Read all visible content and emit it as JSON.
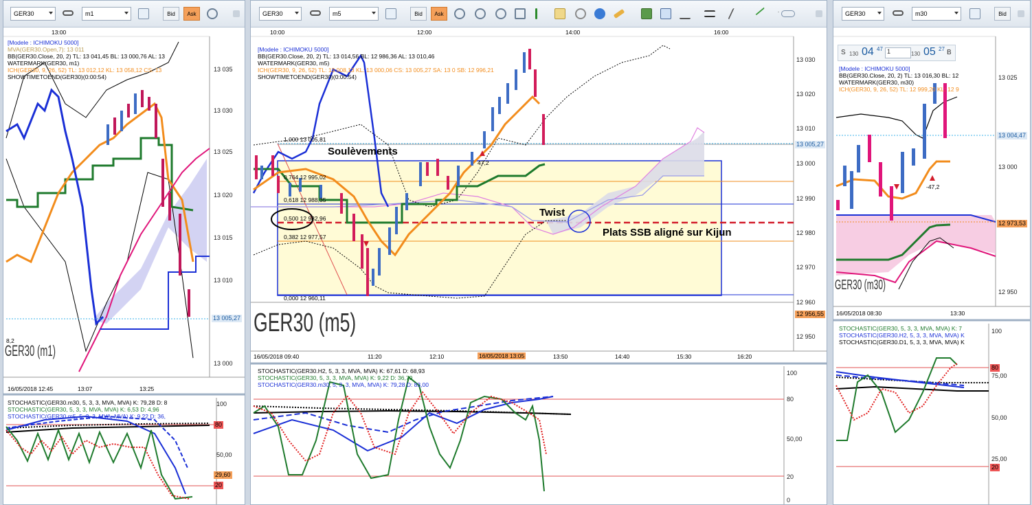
{
  "colors": {
    "ask": "#f5a05a",
    "bid": "#f0f3f6",
    "sar": "#d21c5a",
    "kijun": "#1e7a2c",
    "tenkan": "#f28c1c",
    "bb": "#000000",
    "price_tag": "#dde9f5",
    "alert_tag": "#f5a05a",
    "cloud": "#c8c8f0"
  },
  "left": {
    "symbol": "GER30",
    "timeframe": "m1",
    "bid": "Bid",
    "ask": "Ask",
    "top_time": "13:00",
    "legend": [
      "[Modele : ICHIMOKU 5000]",
      "MVA(GER30.Open,7): 13 011",
      "BB(GER30.Close, 20, 2)  TL: 13 041,45  BL: 13 000,76  AL: 13",
      "WATERMARK(GER30, m1)",
      "ICH(GER30, 9, 26, 52)  TL: 13 012,12  KL: 13 058,12  CS: 13",
      "SHOWTIMETOEND(GER30)(0:00:54)"
    ],
    "yticks": [
      "13 035",
      "13 030",
      "13 025",
      "13 020",
      "13 015",
      "13 010",
      "13 000"
    ],
    "price_tag": "13 005,27",
    "watermark": "GER30 (m1)",
    "xticks": [
      "16/05/2018 12:45",
      "13:07",
      "13:25"
    ],
    "stoch_legend": [
      "STOCHASTIC(GER30.m30, 5, 3, 3, MVA, MVA)  K: 79,28  D: 8",
      "STOCHASTIC(GER30, 5, 3, 3, MVA, MVA)  K: 6,53  D: 4,96",
      "STOCHASTIC(GER30.m5, 5, 3, 3, MVA, MVA)  K: 9,22  D: 36,"
    ],
    "stoch_ticks": [
      "100",
      "80",
      "50,00",
      "29,60",
      "20"
    ],
    "small_note": "8,2"
  },
  "middle": {
    "symbol": "GER30",
    "timeframe": "m5",
    "bid": "Bid",
    "ask": "Ask",
    "top_times": [
      "10:00",
      "12:00",
      "14:00",
      "16:00"
    ],
    "legend": [
      "[Modele : ICHIMOKU 5000]",
      "BB(GER30.Close, 20, 2)  TL: 13 014,56  BL: 12 986,36  AL: 13 010,46",
      "WATERMARK(GER30, m5)",
      "ICH(GER30, 9, 26, 52)  TL: 13 008,13  KL: 13 000,06  CS: 13 005,27  SA: 13 0    SB: 12 996,21",
      "SHOWTIMETOEND(GER30)(0:00:54)"
    ],
    "yticks": [
      "13 030",
      "13 020",
      "13 010",
      "13 000",
      "12 990",
      "12 980",
      "12 970",
      "12 960",
      "12 950"
    ],
    "price_tag": "13 005,27",
    "low_tag": "12 956,55",
    "fib": [
      "1,000 13 005,81",
      "0,764 12 995,02",
      "0,618 12 988,35",
      "0,500 12 982,96",
      "0,382 12 977,57",
      "0,000 12 960,11"
    ],
    "annotations": {
      "soul": "Soulèvements",
      "twist": "Twist",
      "plats": "Plats SSB aligné sur Kijun"
    },
    "small_note": "47,2",
    "watermark": "GER30 (m5)",
    "xticks": [
      "16/05/2018 09:40",
      "11:20",
      "12:10",
      "16/05/2018 13:05",
      "13:50",
      "14:40",
      "15:30",
      "16:20"
    ],
    "stoch_legend": [
      "STOCHASTIC(GER30.H2, 5, 3, 3, MVA, MVA)  K: 67,61  D: 68,93",
      "STOCHASTIC(GER30, 5, 3, 3, MVA, MVA)  K: 9,22  D: 36,79",
      "STOCHASTIC(GER30.m30, 5, 3, 3, MVA, MVA)  K: 79,28  D: 83,00"
    ],
    "stoch_ticks": [
      "100",
      "80",
      "50,00",
      "20",
      "0"
    ]
  },
  "right": {
    "symbol": "GER30",
    "timeframe": "m30",
    "bid": "Bid",
    "sell_label": "S",
    "sell_qty": "130",
    "sell_price": "04",
    "sell_sup": "47",
    "qty_field": "1",
    "buy_qty": "130",
    "buy_price": "05",
    "buy_sup": "27",
    "buy_label": "B",
    "legend": [
      "[Modele : ICHIMOKU 5000]",
      "BB(GER30.Close, 20, 2)  TL: 13 016,30  BL: 12",
      "WATERMARK(GER30, m30)",
      "ICH(GER30, 9, 26, 52)  TL: 12 999,20  KL: 12 9"
    ],
    "yticks": [
      "13 025",
      "13 000",
      "12 950"
    ],
    "price_tag": "13 004,47",
    "alert_tag": "12 973,53",
    "small_note": "-47,2",
    "watermark": "GER30 (m30)",
    "xticks": [
      "16/05/2018 08:30",
      "13:30"
    ],
    "stoch_legend": [
      "STOCHASTIC(GER30, 5, 3, 3, MVA, MVA)  K: 7",
      "STOCHASTIC(GER30.H2, 5, 3, 3, MVA, MVA)  K",
      "STOCHASTIC(GER30.D1, 5, 3, 3, MVA, MVA)  K"
    ],
    "stoch_ticks": [
      "100",
      "80",
      "75,00",
      "50,00",
      "25,00",
      "20"
    ]
  }
}
